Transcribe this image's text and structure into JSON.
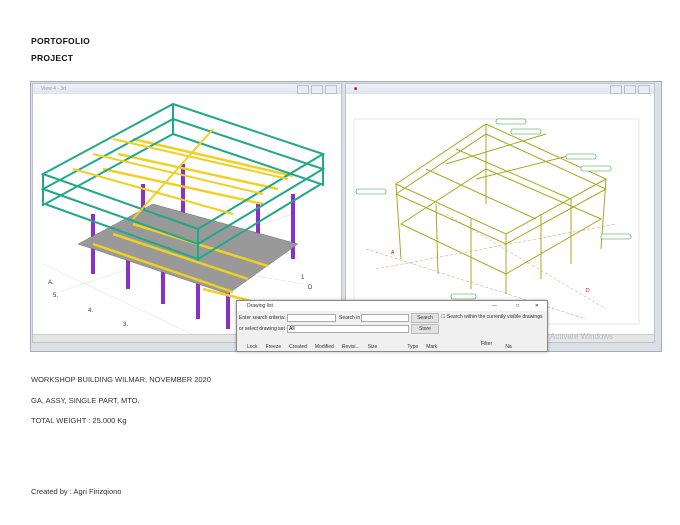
{
  "header": {
    "line1": "PORTOFOLIO",
    "line2": "PROJECT"
  },
  "left_view": {
    "title": "View 4 - 3d"
  },
  "drawing_list": {
    "title": "Drawing list",
    "search_criteria_label": "Enter search criteria:",
    "search_criteria_value": "",
    "search_in_label": "Search in",
    "search_in_value": "",
    "search_button": "Search",
    "visible_checkbox_label": "Search within the currently visible drawings",
    "drawing_set_label": "or select drawing set",
    "drawing_set_value": "All",
    "store_button": "Store",
    "columns": [
      "Lock",
      "Freeze",
      "Created",
      "Modified",
      "Revisi...",
      "Size",
      "Type",
      "Mark",
      "Na"
    ],
    "filter_label": "Filter"
  },
  "watermark": "Activate Windows",
  "body": {
    "line1": "WORKSHOP BUILDING WILMAR, NOVEMBER 2020",
    "line2": "GA, ASSY, SINGLE PART, MTO.",
    "line3": "TOTAL WEIGHT : 25.000 Kg",
    "credit": "Created by : Agri Firizqiono"
  },
  "colors": {
    "rail": "#1fa889",
    "column": "#8b2fc9",
    "beam": "#f0d020",
    "wire": "#a8a820",
    "label": "#2a9a40"
  }
}
